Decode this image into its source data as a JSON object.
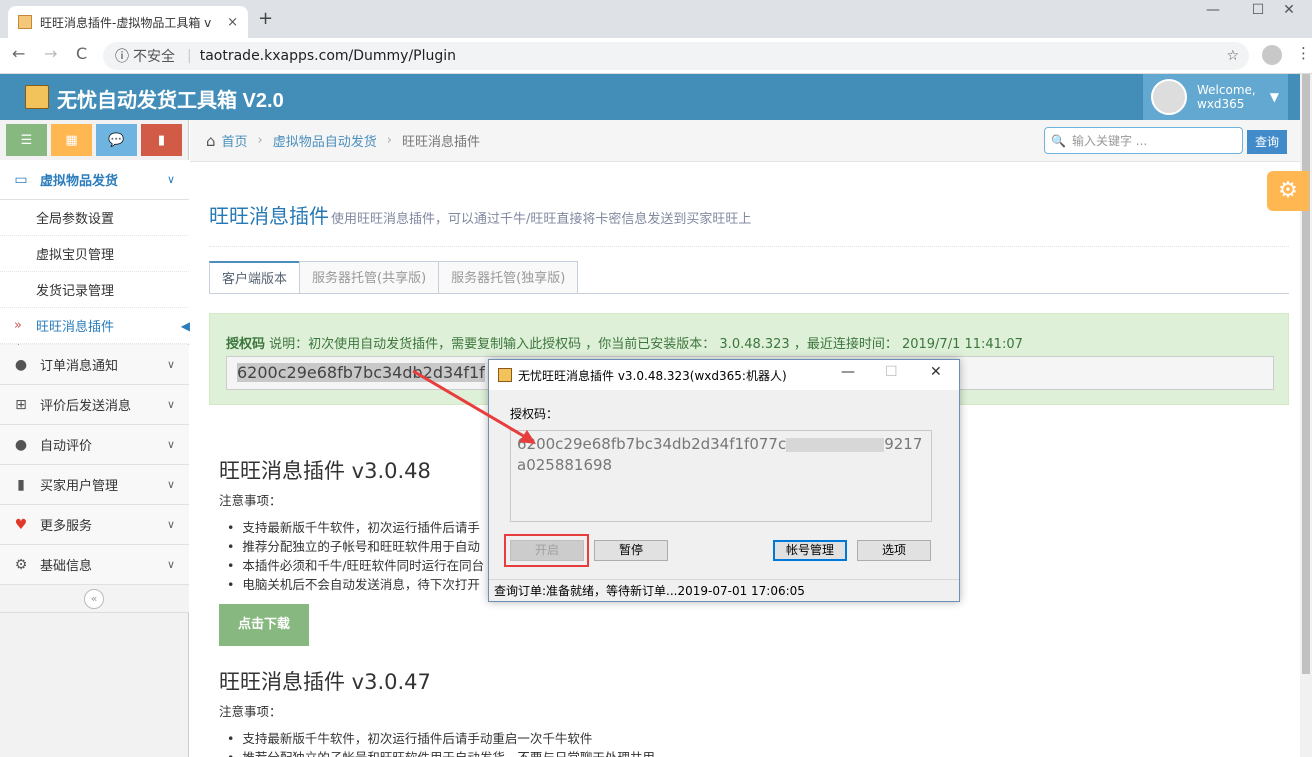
{
  "browser": {
    "tab_title": "旺旺消息插件-虚拟物品工具箱 v",
    "tab_close": "×",
    "new_tab": "+",
    "nav": {
      "back": "←",
      "forward": "→",
      "reload": "C"
    },
    "security_label": "不安全",
    "url": "taotrade.kxapps.com/Dummy/Plugin",
    "window_controls": {
      "min": "—",
      "max": "☐",
      "close": "✕"
    }
  },
  "header": {
    "title": "无忧自动发货工具箱 V2.0",
    "welcome": "Welcome,",
    "username": "wxd365"
  },
  "breadcrumb": {
    "home": "首页",
    "section": "虚拟物品自动发货",
    "current": "旺旺消息插件"
  },
  "search": {
    "placeholder": "输入关键字 ...",
    "button": "查询"
  },
  "sidebar": {
    "main_section": "虚拟物品发货",
    "sub_items": [
      "全局参数设置",
      "虚拟宝贝管理",
      "发货记录管理",
      "旺旺消息插件"
    ],
    "sections": [
      "订单消息通知",
      "评价后发送消息",
      "自动评价",
      "买家用户管理",
      "更多服务",
      "基础信息"
    ]
  },
  "page": {
    "title": "旺旺消息插件",
    "subtitle": "使用旺旺消息插件，可以通过千牛/旺旺直接将卡密信息发送到买家旺旺上",
    "tabs": [
      "客户端版本",
      "服务器托管(共享版)",
      "服务器托管(独享版)"
    ],
    "alert_label": "授权码",
    "alert_text": " 说明：初次使用自动发货插件，需要复制输入此授权码 ，你当前已安装版本： 3.0.48.323 ，最近连接时间： 2019/7/1 11:41:07",
    "auth_code_visible": "6200c29e68fb7bc34db2d34f1f",
    "versions": [
      {
        "title": "旺旺消息插件 v3.0.48",
        "note_label": "注意事项：",
        "items": [
          "支持最新版千牛软件，初次运行插件后请手",
          "推荐分配独立的子帐号和旺旺软件用于自动",
          "本插件必须和千牛/旺旺软件同时运行在同台",
          "电脑关机后不会自动发送消息，待下次打开"
        ],
        "download": "点击下载"
      },
      {
        "title": "旺旺消息插件 v3.0.47",
        "note_label": "注意事项：",
        "items": [
          "支持最新版千牛软件，初次运行插件后请手动重启一次千牛软件",
          "推荐分配独立的子帐号和旺旺软件用于自动发货，不要与日常聊天处理共用"
        ]
      }
    ]
  },
  "dialog": {
    "title": "无忧旺旺消息插件 v3.0.48.323(wxd365:机器人)",
    "label": "授权码：",
    "code_start": "6200c29e68fb7bc34db2d34f1f077c",
    "code_end": "9217a025881698",
    "buttons": {
      "start": "开启",
      "pause": "暂停",
      "accounts": "帐号管理",
      "options": "选项"
    },
    "status": "查询订单:准备就绪，等待新订单...2019-07-01 17:06:05"
  },
  "colors": {
    "header": "#438eb9",
    "highlight": "#e83d3d",
    "alert_bg": "#dff0d8"
  }
}
